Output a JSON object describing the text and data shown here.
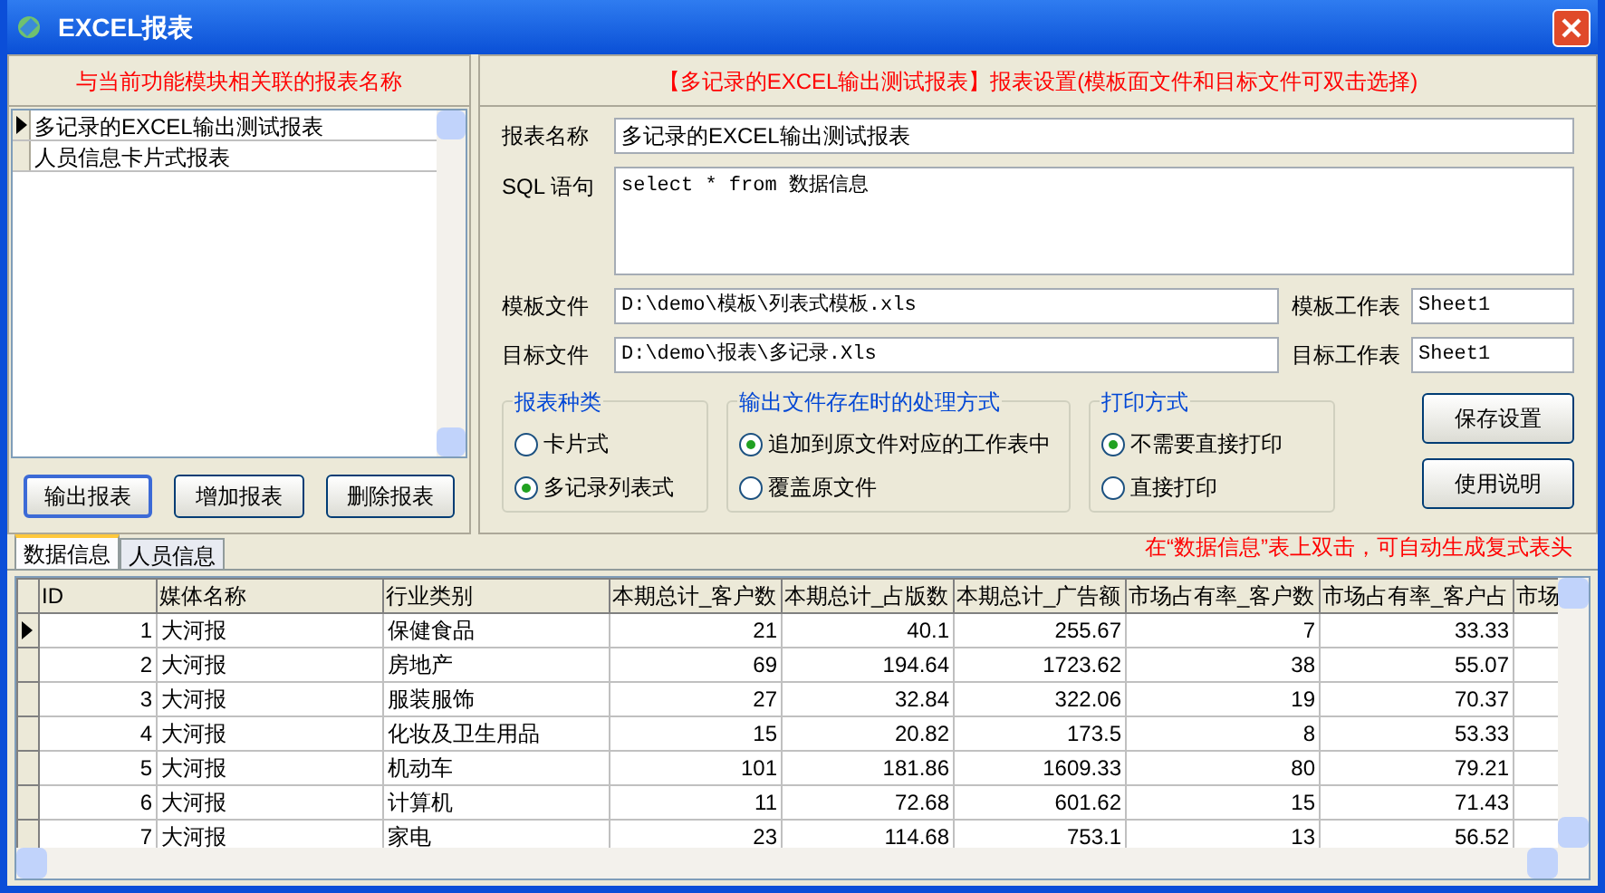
{
  "window": {
    "title": "EXCEL报表"
  },
  "report_list": {
    "heading": "与当前功能模块相关联的报表名称",
    "items": [
      {
        "label": "多记录的EXCEL输出测试报表",
        "selected": true
      },
      {
        "label": "人员信息卡片式报表",
        "selected": false
      }
    ]
  },
  "left_buttons": [
    {
      "label": "输出报表",
      "focused": true
    },
    {
      "label": "增加报表",
      "focused": false
    },
    {
      "label": "删除报表",
      "focused": false
    }
  ],
  "settings": {
    "heading": "【多记录的EXCEL输出测试报表】报表设置(模板面文件和目标文件可双击选择)",
    "report_name": {
      "label": "报表名称",
      "value": "多记录的EXCEL输出测试报表"
    },
    "sql": {
      "label": "SQL 语句",
      "value": "select * from 数据信息"
    },
    "template_file": {
      "label": "模板文件",
      "value": "D:\\demo\\模板\\列表式模板.xls"
    },
    "template_sheet": {
      "label": "模板工作表",
      "value": "Sheet1"
    },
    "target_file": {
      "label": "目标文件",
      "value": "D:\\demo\\报表\\多记录.Xls"
    },
    "target_sheet": {
      "label": "目标工作表",
      "value": "Sheet1"
    },
    "groups": [
      {
        "title": "报表种类",
        "options": [
          {
            "label": "卡片式",
            "selected": false
          },
          {
            "label": "多记录列表式",
            "selected": true
          }
        ]
      },
      {
        "title": "输出文件存在时的处理方式",
        "options": [
          {
            "label": "追加到原文件对应的工作表中",
            "selected": true
          },
          {
            "label": "覆盖原文件",
            "selected": false
          }
        ]
      },
      {
        "title": "打印方式",
        "options": [
          {
            "label": "不需要直接打印",
            "selected": true
          },
          {
            "label": "直接打印",
            "selected": false
          }
        ]
      }
    ],
    "buttons": [
      "保存设置",
      "使用说明"
    ]
  },
  "tabs": [
    {
      "label": "数据信息",
      "selected": true
    },
    {
      "label": "人员信息",
      "selected": false
    }
  ],
  "hint": "在“数据信息”表上双击，可自动生成复式表头",
  "table": {
    "columns": [
      "ID",
      "媒体名称",
      "行业类别",
      "本期总计_客户数",
      "本期总计_占版数",
      "本期总计_广告额",
      "市场占有率_客户数",
      "市场占有率_客户占",
      "市场"
    ],
    "rows": [
      {
        "selected": true,
        "cells": [
          "1",
          "大河报",
          "保健食品",
          "21",
          "40.1",
          "255.67",
          "7",
          "33.33"
        ]
      },
      {
        "selected": false,
        "cells": [
          "2",
          "大河报",
          "房地产",
          "69",
          "194.64",
          "1723.62",
          "38",
          "55.07"
        ]
      },
      {
        "selected": false,
        "cells": [
          "3",
          "大河报",
          "服装服饰",
          "27",
          "32.84",
          "322.06",
          "19",
          "70.37"
        ]
      },
      {
        "selected": false,
        "cells": [
          "4",
          "大河报",
          "化妆及卫生用品",
          "15",
          "20.82",
          "173.5",
          "8",
          "53.33"
        ]
      },
      {
        "selected": false,
        "cells": [
          "5",
          "大河报",
          "机动车",
          "101",
          "181.86",
          "1609.33",
          "80",
          "79.21"
        ]
      },
      {
        "selected": false,
        "cells": [
          "6",
          "大河报",
          "计算机",
          "11",
          "72.68",
          "601.62",
          "15",
          "71.43"
        ]
      },
      {
        "selected": false,
        "cells": [
          "7",
          "大河报",
          "家电",
          "23",
          "114.68",
          "753.1",
          "13",
          "56.52"
        ]
      }
    ]
  }
}
